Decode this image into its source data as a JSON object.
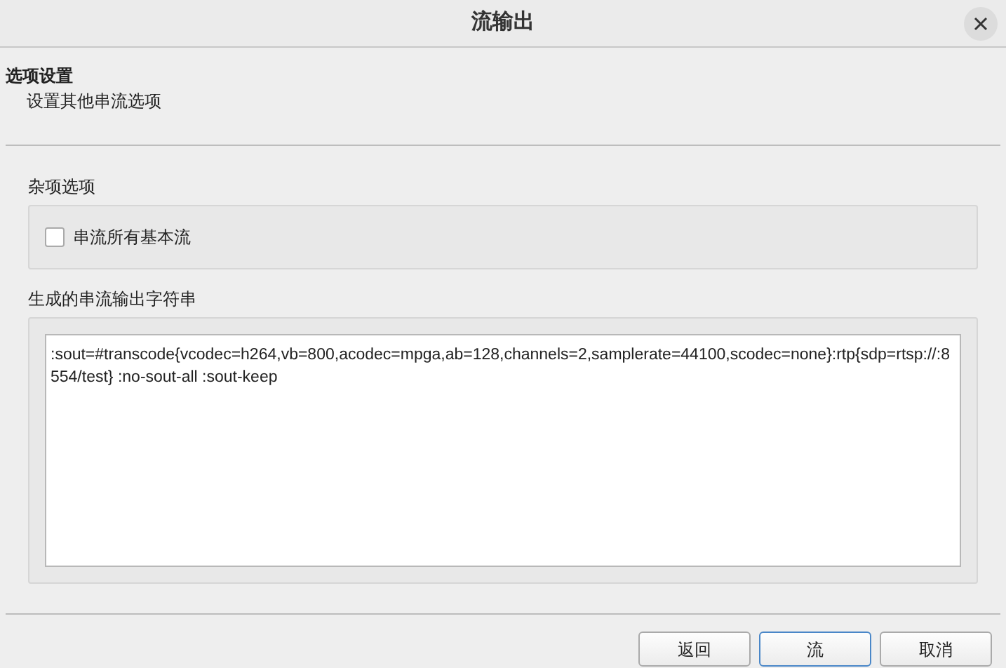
{
  "window": {
    "title": "流输出"
  },
  "header": {
    "title": "选项设置",
    "subtitle": "设置其他串流选项"
  },
  "misc": {
    "label": "杂项选项",
    "checkbox": {
      "label": "串流所有基本流",
      "checked": false
    }
  },
  "output": {
    "label": "生成的串流输出字符串",
    "value": ":sout=#transcode{vcodec=h264,vb=800,acodec=mpga,ab=128,channels=2,samplerate=44100,scodec=none}:rtp{sdp=rtsp://:8554/test} :no-sout-all :sout-keep"
  },
  "buttons": [
    {
      "label": "返回",
      "focused": false
    },
    {
      "label": "流",
      "focused": true
    },
    {
      "label": "取消",
      "focused": false
    }
  ]
}
